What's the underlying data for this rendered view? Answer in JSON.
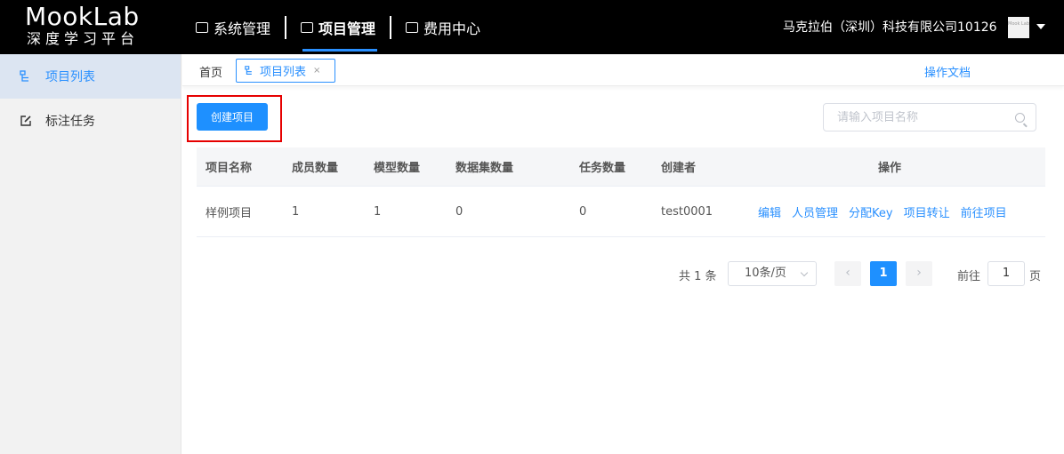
{
  "brand": {
    "title": "MookLab",
    "subtitle": "深度学习平台"
  },
  "nav": {
    "items": [
      {
        "label": "系统管理",
        "icon": "monitor-icon"
      },
      {
        "label": "项目管理",
        "icon": "briefcase-icon",
        "active": true
      },
      {
        "label": "费用中心",
        "icon": "wallet-icon"
      }
    ]
  },
  "header": {
    "company": "马克拉伯（深圳）科技有限公司10126",
    "avatar_text": "Mook Lab"
  },
  "sidebar": {
    "items": [
      {
        "label": "项目列表",
        "icon": "project-list-icon",
        "active": true
      },
      {
        "label": "标注任务",
        "icon": "edit-icon"
      }
    ]
  },
  "tabs": {
    "home": "首页",
    "current": "项目列表",
    "close": "×",
    "docs": "操作文档"
  },
  "toolbar": {
    "create_label": "创建项目",
    "search_placeholder": "请输入项目名称"
  },
  "table": {
    "columns": [
      "项目名称",
      "成员数量",
      "模型数量",
      "数据集数量",
      "任务数量",
      "创建者",
      "操作"
    ],
    "rows": [
      {
        "name": "样例项目",
        "members": "1",
        "models": "1",
        "datasets": "0",
        "tasks": "0",
        "creator": "test0001"
      }
    ],
    "actions": [
      "编辑",
      "人员管理",
      "分配Key",
      "项目转让",
      "前往项目"
    ]
  },
  "pagination": {
    "total": "共 1 条",
    "page_size": "10条/页",
    "prev": "‹",
    "current_page": "1",
    "next": "›",
    "goto_label": "前往",
    "goto_value": "1",
    "page_suffix": "页"
  },
  "colors": {
    "accent": "#1e90ff",
    "topbar": "#000000",
    "highlight": "#e60000"
  }
}
